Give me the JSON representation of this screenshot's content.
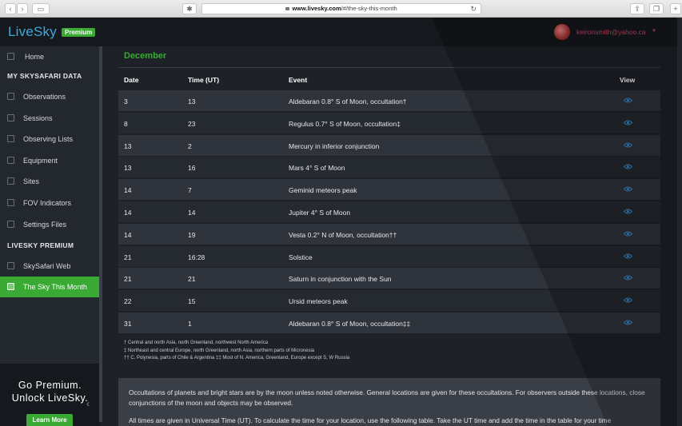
{
  "browser": {
    "url_host": "www.livesky.com",
    "url_path": "/#/the-sky-this-month"
  },
  "app": {
    "logo": "LiveSky",
    "premium_badge": "Premium",
    "user_email": "keironsmith@yahoo.ca"
  },
  "sidebar": {
    "home": "Home",
    "section1": "MY SKYSAFARI DATA",
    "items1": [
      "Observations",
      "Sessions",
      "Observing Lists",
      "Equipment",
      "Sites",
      "FOV Indicators",
      "Settings Files"
    ],
    "section2": "LIVESKY PREMIUM",
    "items2": [
      "SkySafari Web",
      "The Sky This Month"
    ],
    "promo_line1": "Go Premium.",
    "promo_line2": "Unlock LiveSky.",
    "learn_more": "Learn More"
  },
  "main": {
    "month": "December",
    "headers": {
      "date": "Date",
      "time": "Time (UT)",
      "event": "Event",
      "view": "View"
    },
    "rows": [
      {
        "date": "3",
        "time": "13",
        "event": "Aldebaran 0.8° S of Moon, occultation†"
      },
      {
        "date": "8",
        "time": "23",
        "event": "Regulus 0.7° S of Moon, occultation‡"
      },
      {
        "date": "13",
        "time": "2",
        "event": "Mercury in inferior conjunction"
      },
      {
        "date": "13",
        "time": "16",
        "event": "Mars 4° S of Moon"
      },
      {
        "date": "14",
        "time": "7",
        "event": "Geminid meteors peak"
      },
      {
        "date": "14",
        "time": "14",
        "event": "Jupiter 4° S of Moon"
      },
      {
        "date": "14",
        "time": "19",
        "event": "Vesta 0.2° N of Moon, occultation††"
      },
      {
        "date": "21",
        "time": "16:28",
        "event": "Solstice"
      },
      {
        "date": "21",
        "time": "21",
        "event": "Saturn in conjunction with the Sun"
      },
      {
        "date": "22",
        "time": "15",
        "event": "Ursid meteors peak"
      },
      {
        "date": "31",
        "time": "1",
        "event": "Aldebaran 0.8° S of Moon, occultation‡‡"
      }
    ],
    "notes": [
      "† Central and north Asia, north Greenland, northwest North America",
      "‡ Northeast and central Europe, north Greenland, north Asia, northern parts of Micronesia",
      "†† C. Polynesia, parts of Chile & Argentina ‡‡ Most of N. America, Greenland, Europe except S, W Russia"
    ],
    "info_p1": "Occultations of planets and bright stars are by the moon unless noted otherwise. General locations are given for these occultations. For observers outside these locations, close conjunctions of the moon and objects may be observed.",
    "info_p2": "All times are given in Universal Time (UT). To calculate the time for your location, use the following table. Take the UT time and add the time in the table for your time"
  },
  "colors": {
    "accent_green": "#3aaa35",
    "logo_blue": "#3fa9dd",
    "user_pink": "#c44a66",
    "eye_blue": "#3a8fd0"
  },
  "icons": {
    "view": "eye-icon"
  }
}
